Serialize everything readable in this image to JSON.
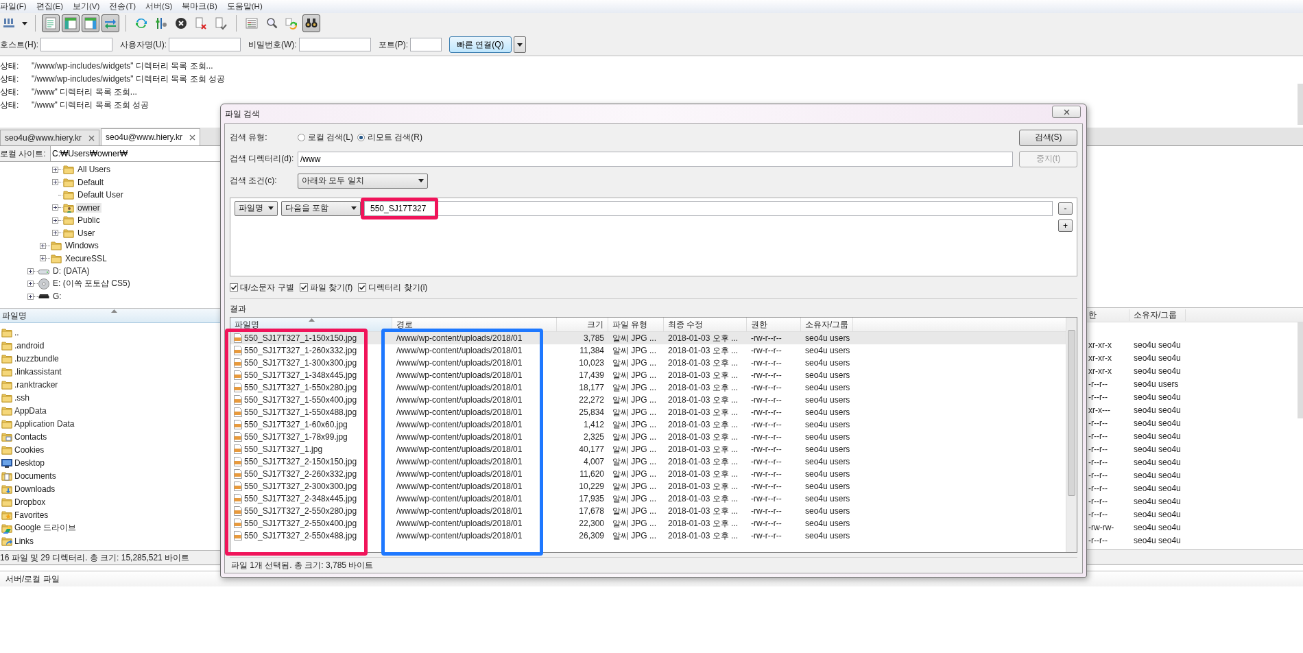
{
  "menu": [
    "파일(F)",
    "편집(E)",
    "보기(V)",
    "전송(T)",
    "서버(S)",
    "북마크(B)",
    "도움말(H)"
  ],
  "toolbar": [
    {
      "kind": "site-manager",
      "pressed": false
    },
    {
      "kind": "log",
      "pressed": true
    },
    {
      "kind": "local-tree",
      "pressed": true
    },
    {
      "kind": "remote-tree",
      "pressed": true
    },
    {
      "kind": "queue",
      "pressed": true
    },
    {
      "kind": "refresh",
      "pressed": false
    },
    {
      "kind": "filters",
      "pressed": false
    },
    {
      "kind": "cancel",
      "pressed": false
    },
    {
      "kind": "disconnect",
      "pressed": false
    },
    {
      "kind": "reconnect",
      "pressed": false
    },
    {
      "kind": "dir-compare",
      "pressed": false
    },
    {
      "kind": "filter-search",
      "pressed": false
    },
    {
      "kind": "sync",
      "pressed": false
    },
    {
      "kind": "find",
      "pressed": true
    }
  ],
  "quickconnect": {
    "fields": [
      {
        "label": "호스트(H):",
        "kind": "wide"
      },
      {
        "label": "사용자명(U):",
        "kind": "wide"
      },
      {
        "label": "비밀번호(W):",
        "kind": "wide"
      },
      {
        "label": "포트(P):",
        "kind": "narrow"
      }
    ],
    "button": "빠른 연결(Q)"
  },
  "log": [
    {
      "label": "상태:",
      "message": "\"/www/wp-includes/widgets\" 디렉터리 목록 조회..."
    },
    {
      "label": "상태:",
      "message": "\"/www/wp-includes/widgets\" 디렉터리 목록 조회 성공"
    },
    {
      "label": "상태:",
      "message": "\"/www\" 디렉터리 목록 조회..."
    },
    {
      "label": "상태:",
      "message": "\"/www\" 디렉터리 목록 조회 성공"
    }
  ],
  "tabs": [
    {
      "label": "seo4u@www.hiery.kr",
      "selected": false
    },
    {
      "label": "seo4u@www.hiery.kr",
      "selected": true
    }
  ],
  "local": {
    "site_label": "로컬 사이트:",
    "path": "C:₩Users₩owner₩",
    "tree": [
      {
        "children": [
          {
            "children": [
              {
                "label": "All Users",
                "kind": "folder",
                "expandable": true,
                "selected": false
              },
              {
                "label": "Default",
                "kind": "folder",
                "expandable": true,
                "selected": false
              },
              {
                "label": "Default User",
                "kind": "folder",
                "expandable": false,
                "selected": false
              },
              {
                "label": "owner",
                "kind": "user-folder",
                "expandable": true,
                "selected": true
              },
              {
                "label": "Public",
                "kind": "folder",
                "expandable": true,
                "selected": false
              },
              {
                "label": "User",
                "kind": "folder",
                "expandable": true,
                "selected": false
              }
            ]
          },
          {
            "label": "Windows",
            "kind": "folder",
            "expandable": true,
            "selected": false
          },
          {
            "label": "XecureSSL",
            "kind": "folder",
            "expandable": true,
            "selected": false
          }
        ]
      },
      {
        "label": "D: (DATA)",
        "kind": "drive",
        "expandable": true,
        "selected": false
      },
      {
        "label": "E: (이쏙 포토샵 CS5)",
        "kind": "disc",
        "expandable": true,
        "selected": false
      },
      {
        "label": "G:",
        "kind": "removable",
        "expandable": true,
        "selected": false
      }
    ],
    "list": {
      "column": {
        "label": "파일명",
        "sorted": true
      },
      "items": [
        {
          "name": "..",
          "kind": "folder"
        },
        {
          "name": ".android",
          "kind": "folder"
        },
        {
          "name": ".buzzbundle",
          "kind": "folder"
        },
        {
          "name": ".linkassistant",
          "kind": "folder"
        },
        {
          "name": ".ranktracker",
          "kind": "folder"
        },
        {
          "name": ".ssh",
          "kind": "folder"
        },
        {
          "name": "AppData",
          "kind": "folder"
        },
        {
          "name": "Application Data",
          "kind": "folder"
        },
        {
          "name": "Contacts",
          "kind": "contacts"
        },
        {
          "name": "Cookies",
          "kind": "folder"
        },
        {
          "name": "Desktop",
          "kind": "desktop"
        },
        {
          "name": "Documents",
          "kind": "documents"
        },
        {
          "name": "Downloads",
          "kind": "downloads"
        },
        {
          "name": "Dropbox",
          "kind": "folder"
        },
        {
          "name": "Favorites",
          "kind": "favorites"
        },
        {
          "name": "Google 드라이브",
          "kind": "drive-folder"
        },
        {
          "name": "Links",
          "kind": "links"
        }
      ]
    },
    "status": "16 파일 및 29 디렉터리. 총 크기: 15,285,521 바이트"
  },
  "remote": {
    "columns": [
      "한",
      "소유자/그룹"
    ],
    "rows": [
      {
        "permissions": "xr-xr-x",
        "owner": "seo4u seo4u"
      },
      {
        "permissions": "xr-xr-x",
        "owner": "seo4u seo4u"
      },
      {
        "permissions": "xr-xr-x",
        "owner": "seo4u seo4u"
      },
      {
        "permissions": "-r--r--",
        "owner": "seo4u users"
      },
      {
        "permissions": "-r--r--",
        "owner": "seo4u seo4u"
      },
      {
        "permissions": "xr-x---",
        "owner": "seo4u seo4u"
      },
      {
        "permissions": "-r--r--",
        "owner": "seo4u seo4u"
      },
      {
        "permissions": "-r--r--",
        "owner": "seo4u seo4u"
      },
      {
        "permissions": "-r--r--",
        "owner": "seo4u seo4u"
      },
      {
        "permissions": "-r--r--",
        "owner": "seo4u seo4u"
      },
      {
        "permissions": "-r--r--",
        "owner": "seo4u seo4u"
      },
      {
        "permissions": "-r--r--",
        "owner": "seo4u seo4u"
      },
      {
        "permissions": "-r--r--",
        "owner": "seo4u seo4u"
      },
      {
        "permissions": "-r--r--",
        "owner": "seo4u seo4u"
      },
      {
        "permissions": "-rw-rw-",
        "owner": "seo4u seo4u"
      },
      {
        "permissions": "-r--r--",
        "owner": "seo4u seo4u"
      }
    ]
  },
  "queue": {
    "column": "서버/로컬 파일"
  },
  "dialog": {
    "title": "파일 검색",
    "search_type": {
      "label": "검색 유형:",
      "options": [
        {
          "label": "로컬 검색(L)",
          "selected": false
        },
        {
          "label": "리모트 검색(R)",
          "selected": true
        }
      ]
    },
    "search_button": {
      "label": "검색(S)",
      "disabled": false
    },
    "directory": {
      "label": "검색 디렉터리(d):",
      "value": "/www"
    },
    "stop_button": {
      "label": "중지(t)",
      "disabled": true
    },
    "condition": {
      "label": "검색 조건(c):",
      "value": "아래와 모두 일치"
    },
    "rules": [
      {
        "field": "파일명",
        "operator": "다음을 포함",
        "value": "550_SJ17T327",
        "remove": "-"
      }
    ],
    "add": "+",
    "options": [
      {
        "label": "대/소문자 구별",
        "checked": true
      },
      {
        "label": "파일 찾기(f)",
        "checked": true
      },
      {
        "label": "디렉터리 찾기(i)",
        "checked": true
      }
    ],
    "results_label": "결과",
    "results": {
      "columns": [
        {
          "label": "파일명",
          "sorted": true
        },
        {
          "label": "경로",
          "sorted": false
        },
        {
          "label": "크기",
          "sorted": false
        },
        {
          "label": "파일 유형",
          "sorted": false
        },
        {
          "label": "최종 수정",
          "sorted": false
        },
        {
          "label": "권한",
          "sorted": false
        },
        {
          "label": "소유자/그룹",
          "sorted": false
        }
      ],
      "rows": [
        {
          "selected": true,
          "cells": [
            "550_SJ17T327_1-150x150.jpg",
            "/www/wp-content/uploads/2018/01",
            "3,785",
            "알씨 JPG ...",
            "2018-01-03 오후 ...",
            "-rw-r--r--",
            "seo4u users"
          ]
        },
        {
          "selected": false,
          "cells": [
            "550_SJ17T327_1-260x332.jpg",
            "/www/wp-content/uploads/2018/01",
            "11,384",
            "알씨 JPG ...",
            "2018-01-03 오후 ...",
            "-rw-r--r--",
            "seo4u users"
          ]
        },
        {
          "selected": false,
          "cells": [
            "550_SJ17T327_1-300x300.jpg",
            "/www/wp-content/uploads/2018/01",
            "10,023",
            "알씨 JPG ...",
            "2018-01-03 오후 ...",
            "-rw-r--r--",
            "seo4u users"
          ]
        },
        {
          "selected": false,
          "cells": [
            "550_SJ17T327_1-348x445.jpg",
            "/www/wp-content/uploads/2018/01",
            "17,439",
            "알씨 JPG ...",
            "2018-01-03 오후 ...",
            "-rw-r--r--",
            "seo4u users"
          ]
        },
        {
          "selected": false,
          "cells": [
            "550_SJ17T327_1-550x280.jpg",
            "/www/wp-content/uploads/2018/01",
            "18,177",
            "알씨 JPG ...",
            "2018-01-03 오후 ...",
            "-rw-r--r--",
            "seo4u users"
          ]
        },
        {
          "selected": false,
          "cells": [
            "550_SJ17T327_1-550x400.jpg",
            "/www/wp-content/uploads/2018/01",
            "22,272",
            "알씨 JPG ...",
            "2018-01-03 오후 ...",
            "-rw-r--r--",
            "seo4u users"
          ]
        },
        {
          "selected": false,
          "cells": [
            "550_SJ17T327_1-550x488.jpg",
            "/www/wp-content/uploads/2018/01",
            "25,834",
            "알씨 JPG ...",
            "2018-01-03 오후 ...",
            "-rw-r--r--",
            "seo4u users"
          ]
        },
        {
          "selected": false,
          "cells": [
            "550_SJ17T327_1-60x60.jpg",
            "/www/wp-content/uploads/2018/01",
            "1,412",
            "알씨 JPG ...",
            "2018-01-03 오후 ...",
            "-rw-r--r--",
            "seo4u users"
          ]
        },
        {
          "selected": false,
          "cells": [
            "550_SJ17T327_1-78x99.jpg",
            "/www/wp-content/uploads/2018/01",
            "2,325",
            "알씨 JPG ...",
            "2018-01-03 오후 ...",
            "-rw-r--r--",
            "seo4u users"
          ]
        },
        {
          "selected": false,
          "cells": [
            "550_SJ17T327_1.jpg",
            "/www/wp-content/uploads/2018/01",
            "40,177",
            "알씨 JPG ...",
            "2018-01-03 오후 ...",
            "-rw-r--r--",
            "seo4u users"
          ]
        },
        {
          "selected": false,
          "cells": [
            "550_SJ17T327_2-150x150.jpg",
            "/www/wp-content/uploads/2018/01",
            "4,007",
            "알씨 JPG ...",
            "2018-01-03 오후 ...",
            "-rw-r--r--",
            "seo4u users"
          ]
        },
        {
          "selected": false,
          "cells": [
            "550_SJ17T327_2-260x332.jpg",
            "/www/wp-content/uploads/2018/01",
            "11,620",
            "알씨 JPG ...",
            "2018-01-03 오후 ...",
            "-rw-r--r--",
            "seo4u users"
          ]
        },
        {
          "selected": false,
          "cells": [
            "550_SJ17T327_2-300x300.jpg",
            "/www/wp-content/uploads/2018/01",
            "10,229",
            "알씨 JPG ...",
            "2018-01-03 오후 ...",
            "-rw-r--r--",
            "seo4u users"
          ]
        },
        {
          "selected": false,
          "cells": [
            "550_SJ17T327_2-348x445.jpg",
            "/www/wp-content/uploads/2018/01",
            "17,935",
            "알씨 JPG ...",
            "2018-01-03 오후 ...",
            "-rw-r--r--",
            "seo4u users"
          ]
        },
        {
          "selected": false,
          "cells": [
            "550_SJ17T327_2-550x280.jpg",
            "/www/wp-content/uploads/2018/01",
            "17,678",
            "알씨 JPG ...",
            "2018-01-03 오후 ...",
            "-rw-r--r--",
            "seo4u users"
          ]
        },
        {
          "selected": false,
          "cells": [
            "550_SJ17T327_2-550x400.jpg",
            "/www/wp-content/uploads/2018/01",
            "22,300",
            "알씨 JPG ...",
            "2018-01-03 오후 ...",
            "-rw-r--r--",
            "seo4u users"
          ]
        },
        {
          "selected": false,
          "cells": [
            "550_SJ17T327_2-550x488.jpg",
            "/www/wp-content/uploads/2018/01",
            "26,309",
            "알씨 JPG ...",
            "2018-01-03 오후 ...",
            "-rw-r--r--",
            "seo4u users"
          ]
        }
      ]
    },
    "status": "파일 1개 선택됨. 총 크기: 3,785 바이트"
  },
  "annotations": [
    {
      "kind": "search-value",
      "color": "#f0145a"
    },
    {
      "kind": "filename-column",
      "color": "#f0145a"
    },
    {
      "kind": "path-column",
      "color": "#1e78ff"
    }
  ]
}
